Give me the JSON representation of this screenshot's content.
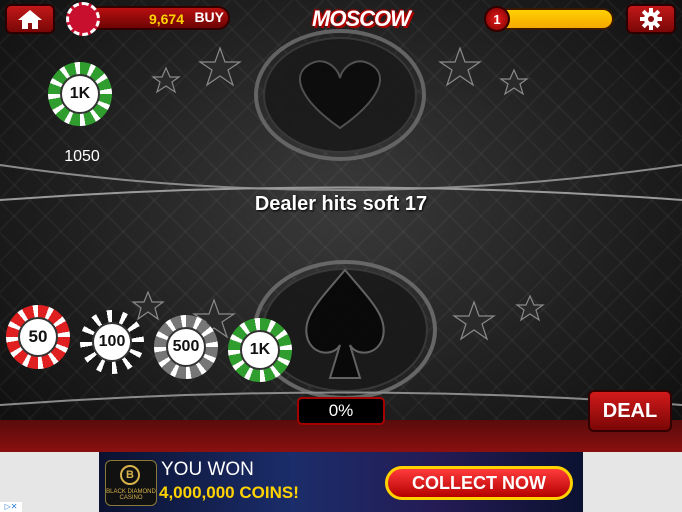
{
  "header": {
    "balance": "9,674",
    "buy_label": "BUY",
    "title": "MOSCOW",
    "level": "1"
  },
  "colors": {
    "accent": "#c21818",
    "gold": "#ffd200",
    "felt": "#1e1e1e"
  },
  "icons": {
    "home": "home-icon",
    "settings": "gear-icon",
    "balance": "poker-chip-icon"
  },
  "table": {
    "bet_chip_label": "1K",
    "bet_amount": "1050",
    "dealer_rule": "Dealer hits soft 17"
  },
  "chips": [
    {
      "label": "50",
      "color": "red"
    },
    {
      "label": "100",
      "color": "black"
    },
    {
      "label": "500",
      "color": "gray"
    },
    {
      "label": "1K",
      "color": "green"
    }
  ],
  "controls": {
    "progress": "0%",
    "deal_label": "DEAL"
  },
  "ad": {
    "logo_mark": "B",
    "logo_text": "BLACK DIAMOND CASINO",
    "headline": "YOU WON",
    "coins": "4,000,000 COINS!",
    "cta": "COLLECT NOW",
    "corner": "▷✕"
  }
}
